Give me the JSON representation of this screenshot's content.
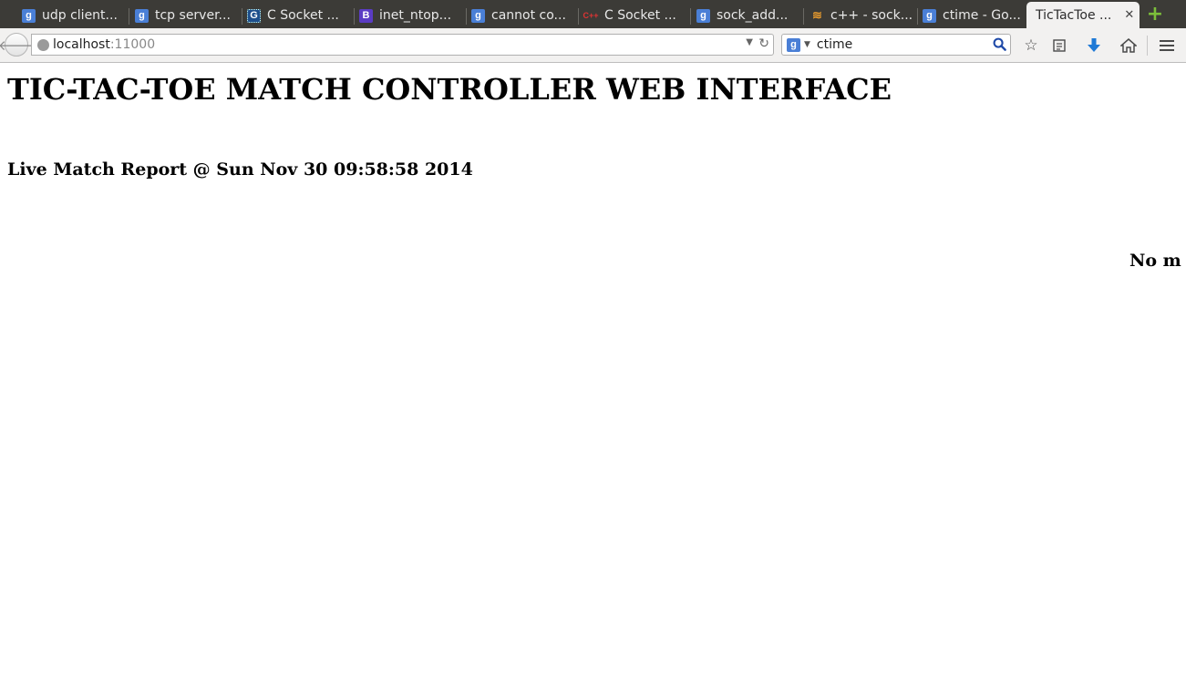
{
  "tabs": [
    {
      "label": "udp client...",
      "icon": "google-icon"
    },
    {
      "label": "tcp server...",
      "icon": "google-icon"
    },
    {
      "label": "C Socket ...",
      "icon": "site-icon"
    },
    {
      "label": "inet_ntop...",
      "icon": "bootstrap-icon"
    },
    {
      "label": "cannot co...",
      "icon": "google-icon"
    },
    {
      "label": "C Socket ...",
      "icon": "cpp-icon"
    },
    {
      "label": "sock_add...",
      "icon": "google-icon"
    },
    {
      "label": "c++ - sock...",
      "icon": "stackoverflow-icon"
    },
    {
      "label": "ctime - Go...",
      "icon": "google-icon"
    },
    {
      "label": "TicTacToe ...",
      "icon": "page-icon",
      "active": true
    }
  ],
  "address": {
    "host": "localhost",
    "port": ":11000"
  },
  "search": {
    "value": "ctime"
  },
  "page": {
    "title": "TIC-TAC-TOE MATCH CONTROLLER WEB INTERFACE",
    "report": "Live Match Report @ Sun Nov 30 09:58:58 2014",
    "status_partial": "No m"
  }
}
